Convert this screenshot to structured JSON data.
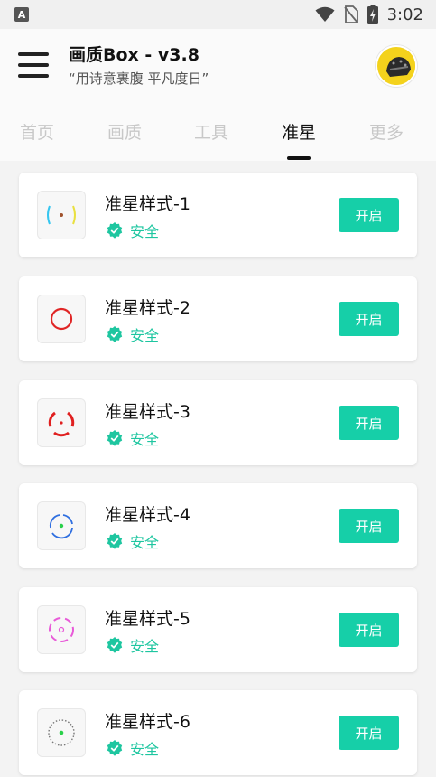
{
  "status_bar": {
    "app_icon_letter": "A",
    "time": "3:02",
    "icons": [
      "wifi-icon",
      "no-sim-icon",
      "battery-charging-icon"
    ]
  },
  "header": {
    "title": "画质Box - v3.8",
    "subtitle": "“用诗意裹腹 平凡度日”"
  },
  "tabs": [
    {
      "label": "首页",
      "active": false
    },
    {
      "label": "画质",
      "active": false
    },
    {
      "label": "工具",
      "active": false
    },
    {
      "label": "准星",
      "active": true
    },
    {
      "label": "更多",
      "active": false
    }
  ],
  "colors": {
    "accent": "#16cfa8",
    "safe_text": "#1ec6a0"
  },
  "items": [
    {
      "name": "准星样式-1",
      "status": "安全",
      "button": "开启",
      "icon": "crosshair-brackets-icon"
    },
    {
      "name": "准星样式-2",
      "status": "安全",
      "button": "开启",
      "icon": "crosshair-red-circle-icon"
    },
    {
      "name": "准星样式-3",
      "status": "安全",
      "button": "开启",
      "icon": "crosshair-red-arcs-icon"
    },
    {
      "name": "准星样式-4",
      "status": "安全",
      "button": "开启",
      "icon": "crosshair-blue-ring-icon"
    },
    {
      "name": "准星样式-5",
      "status": "安全",
      "button": "开启",
      "icon": "crosshair-pink-dashed-icon"
    },
    {
      "name": "准星样式-6",
      "status": "安全",
      "button": "开启",
      "icon": "crosshair-dotted-ring-icon"
    }
  ]
}
